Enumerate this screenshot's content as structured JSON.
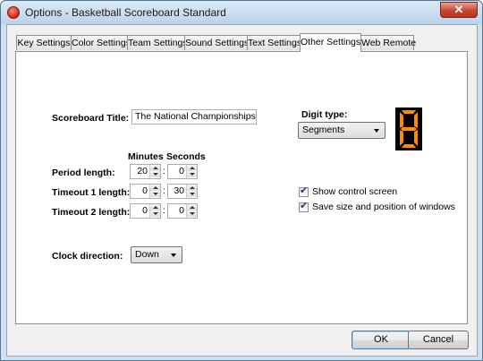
{
  "window": {
    "title": "Options - Basketball Scoreboard Standard",
    "close_glyph": "✕"
  },
  "tabs": [
    {
      "label": "Key Settings",
      "active": false
    },
    {
      "label": "Color Settings",
      "active": false
    },
    {
      "label": "Team Settings",
      "active": false
    },
    {
      "label": "Sound Settings",
      "active": false
    },
    {
      "label": "Text Settings",
      "active": false
    },
    {
      "label": "Other Settings",
      "active": true
    },
    {
      "label": "Web Remote",
      "active": false
    }
  ],
  "other_settings": {
    "scoreboard_title_label": "Scoreboard Title:",
    "scoreboard_title_value": "The National Championships",
    "digit_type_label": "Digit type:",
    "digit_type_value": "Segments",
    "digit_preview": "8",
    "digit_color": "#ff8c00",
    "minutes_header": "Minutes",
    "seconds_header": "Seconds",
    "period_length_label": "Period length:",
    "period_minutes": "20",
    "period_seconds": "0",
    "timeout1_label": "Timeout 1 length:",
    "timeout1_minutes": "0",
    "timeout1_seconds": "30",
    "timeout2_label": "Timeout 2 length:",
    "timeout2_minutes": "0",
    "timeout2_seconds": "0",
    "colon": ":",
    "clock_direction_label": "Clock direction:",
    "clock_direction_value": "Down",
    "show_control_screen_label": "Show control screen",
    "show_control_screen_checked": true,
    "save_size_label": "Save size and position of windows",
    "save_size_checked": true,
    "check_glyph": "✔"
  },
  "buttons": {
    "ok": "OK",
    "cancel": "Cancel"
  },
  "icons": {
    "app": "app-ball-icon",
    "close": "close-icon",
    "spin_up": "spin-up-icon",
    "spin_down": "spin-down-icon",
    "dropdown": "chevron-down-icon"
  }
}
